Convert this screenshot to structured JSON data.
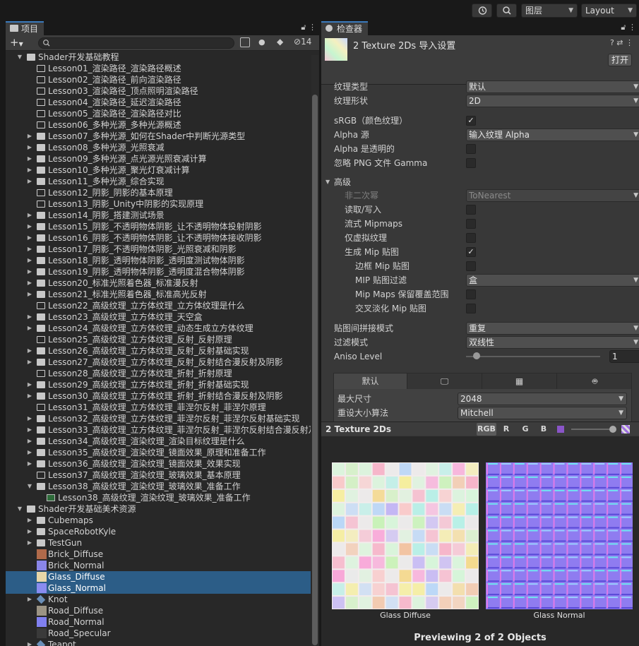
{
  "topbar": {
    "layer_label": "图层",
    "layout_label": "Layout"
  },
  "project": {
    "tab_label": "项目",
    "hidden_count": "14",
    "tree": [
      {
        "label": "Shader开发基础教程",
        "type": "folder-open",
        "depth": 0,
        "arrow": "open"
      },
      {
        "label": "Lesson01_渲染路径_渲染路径概述",
        "type": "folder-empty",
        "depth": 1,
        "arrow": "none"
      },
      {
        "label": "Lesson02_渲染路径_前向渲染路径",
        "type": "folder-empty",
        "depth": 1,
        "arrow": "none"
      },
      {
        "label": "Lesson03_渲染路径_顶点照明渲染路径",
        "type": "folder-empty",
        "depth": 1,
        "arrow": "none"
      },
      {
        "label": "Lesson04_渲染路径_延迟渲染路径",
        "type": "folder-empty",
        "depth": 1,
        "arrow": "none"
      },
      {
        "label": "Lesson05_渲染路径_渲染路径对比",
        "type": "folder-empty",
        "depth": 1,
        "arrow": "none"
      },
      {
        "label": "Lesson06_多种光源_多种光源概述",
        "type": "folder-empty",
        "depth": 1,
        "arrow": "none"
      },
      {
        "label": "Lesson07_多种光源_如何在Shader中判断光源类型",
        "type": "folder",
        "depth": 1,
        "arrow": "closed"
      },
      {
        "label": "Lesson08_多种光源_光照衰减",
        "type": "folder",
        "depth": 1,
        "arrow": "closed"
      },
      {
        "label": "Lesson09_多种光源_点光源光照衰减计算",
        "type": "folder",
        "depth": 1,
        "arrow": "closed"
      },
      {
        "label": "Lesson10_多种光源_聚光灯衰减计算",
        "type": "folder",
        "depth": 1,
        "arrow": "closed"
      },
      {
        "label": "Lesson11_多种光源_综合实现",
        "type": "folder",
        "depth": 1,
        "arrow": "closed"
      },
      {
        "label": "Lesson12_阴影_阴影的基本原理",
        "type": "folder-empty",
        "depth": 1,
        "arrow": "none"
      },
      {
        "label": "Lesson13_阴影_Unity中阴影的实现原理",
        "type": "folder-empty",
        "depth": 1,
        "arrow": "none"
      },
      {
        "label": "Lesson14_阴影_搭建测试场景",
        "type": "folder",
        "depth": 1,
        "arrow": "closed"
      },
      {
        "label": "Lesson15_阴影_不透明物体阴影_让不透明物体投射阴影",
        "type": "folder",
        "depth": 1,
        "arrow": "closed"
      },
      {
        "label": "Lesson16_阴影_不透明物体阴影_让不透明物体接收阴影",
        "type": "folder",
        "depth": 1,
        "arrow": "closed"
      },
      {
        "label": "Lesson17_阴影_不透明物体阴影_光照衰减和阴影",
        "type": "folder",
        "depth": 1,
        "arrow": "closed"
      },
      {
        "label": "Lesson18_阴影_透明物体阴影_透明度测试物体阴影",
        "type": "folder",
        "depth": 1,
        "arrow": "closed"
      },
      {
        "label": "Lesson19_阴影_透明物体阴影_透明度混合物体阴影",
        "type": "folder",
        "depth": 1,
        "arrow": "closed"
      },
      {
        "label": "Lesson20_标准光照着色器_标准漫反射",
        "type": "folder",
        "depth": 1,
        "arrow": "closed"
      },
      {
        "label": "Lesson21_标准光照着色器_标准高光反射",
        "type": "folder",
        "depth": 1,
        "arrow": "closed"
      },
      {
        "label": "Lesson22_高级纹理_立方体纹理_立方体纹理是什么",
        "type": "folder-empty",
        "depth": 1,
        "arrow": "none"
      },
      {
        "label": "Lesson23_高级纹理_立方体纹理_天空盒",
        "type": "folder",
        "depth": 1,
        "arrow": "closed"
      },
      {
        "label": "Lesson24_高级纹理_立方体纹理_动态生成立方体纹理",
        "type": "folder",
        "depth": 1,
        "arrow": "closed"
      },
      {
        "label": "Lesson25_高级纹理_立方体纹理_反射_反射原理",
        "type": "folder-empty",
        "depth": 1,
        "arrow": "none"
      },
      {
        "label": "Lesson26_高级纹理_立方体纹理_反射_反射基础实现",
        "type": "folder",
        "depth": 1,
        "arrow": "closed"
      },
      {
        "label": "Lesson27_高级纹理_立方体纹理_反射_反射结合漫反射及阴影",
        "type": "folder",
        "depth": 1,
        "arrow": "closed"
      },
      {
        "label": "Lesson28_高级纹理_立方体纹理_折射_折射原理",
        "type": "folder-empty",
        "depth": 1,
        "arrow": "none"
      },
      {
        "label": "Lesson29_高级纹理_立方体纹理_折射_折射基础实现",
        "type": "folder",
        "depth": 1,
        "arrow": "closed"
      },
      {
        "label": "Lesson30_高级纹理_立方体纹理_折射_折射结合漫反射及阴影",
        "type": "folder",
        "depth": 1,
        "arrow": "closed"
      },
      {
        "label": "Lesson31_高级纹理_立方体纹理_菲涅尔反射_菲涅尔原理",
        "type": "folder-empty",
        "depth": 1,
        "arrow": "none"
      },
      {
        "label": "Lesson32_高级纹理_立方体纹理_菲涅尔反射_菲涅尔反射基础实现",
        "type": "folder",
        "depth": 1,
        "arrow": "closed"
      },
      {
        "label": "Lesson33_高级纹理_立方体纹理_菲涅尔反射_菲涅尔反射结合漫反射及",
        "type": "folder",
        "depth": 1,
        "arrow": "closed"
      },
      {
        "label": "Lesson34_高级纹理_渲染纹理_渲染目标纹理是什么",
        "type": "folder",
        "depth": 1,
        "arrow": "closed"
      },
      {
        "label": "Lesson35_高级纹理_渲染纹理_镜面效果_原理和准备工作",
        "type": "folder",
        "depth": 1,
        "arrow": "closed"
      },
      {
        "label": "Lesson36_高级纹理_渲染纹理_镜面效果_效果实现",
        "type": "folder",
        "depth": 1,
        "arrow": "closed"
      },
      {
        "label": "Lesson37_高级纹理_渲染纹理_玻璃效果_基本原理",
        "type": "folder-empty",
        "depth": 1,
        "arrow": "none"
      },
      {
        "label": "Lesson38_高级纹理_渲染纹理_玻璃效果_准备工作",
        "type": "folder-open",
        "depth": 1,
        "arrow": "open"
      },
      {
        "label": "Lesson38_高级纹理_渲染纹理_玻璃效果_准备工作",
        "type": "script",
        "depth": 2,
        "arrow": "none"
      },
      {
        "label": "Shader开发基础美术资源",
        "type": "folder-open",
        "depth": 0,
        "arrow": "open"
      },
      {
        "label": "Cubemaps",
        "type": "folder",
        "depth": 1,
        "arrow": "closed"
      },
      {
        "label": "SpaceRobotKyle",
        "type": "folder",
        "depth": 1,
        "arrow": "closed"
      },
      {
        "label": "TestGun",
        "type": "folder",
        "depth": 1,
        "arrow": "closed"
      },
      {
        "label": "Brick_Diffuse",
        "type": "tex",
        "color": "#b06a4a",
        "depth": 1,
        "arrow": "none"
      },
      {
        "label": "Brick_Normal",
        "type": "tex",
        "color": "#8a86e8",
        "depth": 1,
        "arrow": "none"
      },
      {
        "label": "Glass_Diffuse",
        "type": "tex",
        "color": "#e8d6a8",
        "depth": 1,
        "arrow": "none",
        "selected": true
      },
      {
        "label": "Glass_Normal",
        "type": "tex",
        "color": "#8a8cf0",
        "depth": 1,
        "arrow": "none",
        "selected": true
      },
      {
        "label": "Knot",
        "type": "prefab",
        "depth": 1,
        "arrow": "closed"
      },
      {
        "label": "Road_Diffuse",
        "type": "tex",
        "color": "#9c9484",
        "depth": 1,
        "arrow": "none"
      },
      {
        "label": "Road_Normal",
        "type": "tex",
        "color": "#8080f0",
        "depth": 1,
        "arrow": "none"
      },
      {
        "label": "Road_Specular",
        "type": "tex",
        "color": "#3a3a3a",
        "depth": 1,
        "arrow": "none"
      },
      {
        "label": "Teapot",
        "type": "prefab",
        "depth": 1,
        "arrow": "closed"
      }
    ]
  },
  "inspector": {
    "tab_label": "检查器",
    "title": "2 Texture 2Ds 导入设置",
    "open_button": "打开",
    "texture_type": {
      "label": "纹理类型",
      "value": "默认"
    },
    "texture_shape": {
      "label": "纹理形状",
      "value": "2D"
    },
    "srgb": {
      "label": "sRGB（颜色纹理）",
      "checked": true
    },
    "alpha_source": {
      "label": "Alpha 源",
      "value": "输入纹理 Alpha"
    },
    "alpha_transparency": {
      "label": "Alpha 是透明的",
      "checked": false
    },
    "ignore_png_gamma": {
      "label": "忽略 PNG 文件 Gamma",
      "checked": false
    },
    "advanced": {
      "label": "高级",
      "npot": {
        "label": "非二次幂",
        "value": "ToNearest"
      },
      "read_write": {
        "label": "读取/写入",
        "checked": false
      },
      "streaming_mipmaps": {
        "label": "流式 Mipmaps",
        "checked": false
      },
      "virtual_texture_only": {
        "label": "仅虚拟纹理",
        "checked": false
      },
      "generate_mipmap": {
        "label": "生成 Mip 贴图",
        "checked": true
      },
      "border_mipmaps": {
        "label": "边框 Mip 贴图",
        "checked": false
      },
      "mipmap_filter": {
        "label": "MIP 贴图过滤",
        "value": "盒"
      },
      "preserve_coverage": {
        "label": "Mip Maps 保留覆盖范围",
        "checked": false
      },
      "fadeout_mips": {
        "label": "交叉淡化 Mip 贴图",
        "checked": false
      }
    },
    "wrap_mode": {
      "label": "贴图间拼接模式",
      "value": "重复"
    },
    "filter_mode": {
      "label": "过滤模式",
      "value": "双线性"
    },
    "aniso_level": {
      "label": "Aniso Level",
      "value": "1",
      "level": 0
    },
    "platform": {
      "default_tab": "默认",
      "max_size": {
        "label": "最大尺寸",
        "value": "2048"
      },
      "resize_algorithm": {
        "label": "重设大小算法",
        "value": "Mitchell"
      }
    },
    "preview": {
      "title": "2 Texture 2Ds",
      "channels": [
        "RGB",
        "R",
        "G",
        "B"
      ],
      "captions": [
        "Glass Diffuse",
        "Glass Normal"
      ],
      "count_text": "Previewing 2 of 2 Objects"
    }
  }
}
